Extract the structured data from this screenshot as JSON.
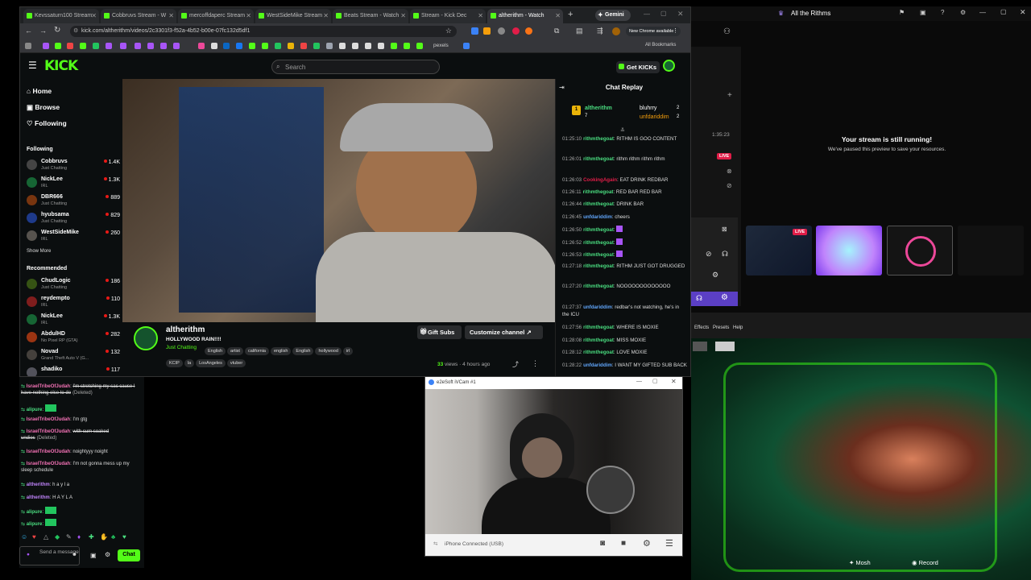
{
  "browser": {
    "tabs": [
      "Kevssaturn100 Stream",
      "Cobbruvs Stream - W",
      "mercoffdaperc Stream",
      "WestSideMike Stream",
      "Beats Stream - Watch",
      "Stream - Kick Dec",
      "altherithm - Watch"
    ],
    "gemini_label": "Gemini",
    "url": "kick.com/altherithm/videos/2c3301f3-f52a-4b52-b00e-07fc132d5df1",
    "update_label": "New Chrome available",
    "bookmarks_label": "pexels",
    "all_bookmarks": "All Bookmarks"
  },
  "kick": {
    "logo": "KICK",
    "search_placeholder": "Search",
    "get_kicks": "Get KICKs",
    "nav": {
      "home": "Home",
      "browse": "Browse",
      "following": "Following"
    },
    "following_title": "Following",
    "following": [
      {
        "name": "Cobbruvs",
        "category": "Just Chatting",
        "viewers": "1.4K"
      },
      {
        "name": "NickLee",
        "category": "IRL",
        "viewers": "1.3K"
      },
      {
        "name": "DBR666",
        "category": "Just Chatting",
        "viewers": "889"
      },
      {
        "name": "hyubsama",
        "category": "Just Chatting",
        "viewers": "829"
      },
      {
        "name": "WestSideMike",
        "category": "IRL",
        "viewers": "260"
      }
    ],
    "show_more": "Show More",
    "recommended_title": "Recommended",
    "recommended": [
      {
        "name": "ChudLogic",
        "category": "Just Chatting",
        "viewers": "186"
      },
      {
        "name": "reydempto",
        "category": "IRL",
        "viewers": "110"
      },
      {
        "name": "NickLee",
        "category": "IRL",
        "viewers": "1.3K"
      },
      {
        "name": "AbdulHD",
        "category": "No Pixel RP (GTA)",
        "viewers": "282"
      },
      {
        "name": "Novad",
        "category": "Grand Theft Auto V (G...",
        "viewers": "132"
      },
      {
        "name": "shadiko",
        "category": "",
        "viewers": "117"
      }
    ],
    "stream": {
      "channel": "altherithm",
      "title": "HOLLYWOOD RAIN!!!!",
      "category": "Just Chatting",
      "tags": [
        "English",
        "artist",
        "california",
        "english",
        "English",
        "hollywood",
        "irl"
      ],
      "tags2": [
        "KCIP",
        "la",
        "LosAngeles",
        "vtuber"
      ],
      "gift_subs": "Gift Subs",
      "customize": "Customize channel",
      "views": "33",
      "views_label": "views",
      "time_ago": "4 hours ago"
    },
    "chat": {
      "title": "Chat Replay",
      "leaders": [
        {
          "rank": "1",
          "name": "altherithm",
          "count": "7"
        },
        {
          "name": "bluhrry",
          "count": "2"
        },
        {
          "name": "unfdariddim",
          "count": "2"
        }
      ],
      "messages": [
        {
          "time": "01:25:10",
          "user": "rithmthegoat",
          "text": "RITHM IS GOO CONTENT",
          "color": "#4ade80"
        },
        {
          "time": "01:26:01",
          "user": "rithmthegoat",
          "text": "rithm rithm rithm rithm",
          "color": "#4ade80"
        },
        {
          "time": "01:26:03",
          "user": "CookingAgain",
          "text": "EAT DRINK REDBAR",
          "color": "#e11d48"
        },
        {
          "time": "01:26:11",
          "user": "rithmthegoat",
          "text": "RED BAR RED BAR",
          "color": "#4ade80"
        },
        {
          "time": "01:26:44",
          "user": "rithmthegoat",
          "text": "DRINK BAR",
          "color": "#4ade80"
        },
        {
          "time": "01:26:45",
          "user": "unfdariddim",
          "text": "cheers",
          "color": "#60a5fa"
        },
        {
          "time": "01:26:50",
          "user": "rithmthegoat",
          "text": "",
          "color": "#4ade80"
        },
        {
          "time": "01:26:52",
          "user": "rithmthegoat",
          "text": "",
          "color": "#4ade80"
        },
        {
          "time": "01:26:53",
          "user": "rithmthegoat",
          "text": "",
          "color": "#4ade80"
        },
        {
          "time": "01:27:18",
          "user": "rithmthegoat",
          "text": "RITHM JUST GOT DRUGGED",
          "color": "#4ade80"
        },
        {
          "time": "01:27:20",
          "user": "rithmthegoat",
          "text": "NOOOOOOOOOOOOO",
          "color": "#4ade80"
        },
        {
          "time": "01:27:37",
          "user": "unfdariddim",
          "text": "redbar's not watching, he's in the ICU",
          "color": "#60a5fa"
        },
        {
          "time": "01:27:56",
          "user": "rithmthegoat",
          "text": "WHERE IS MOXIE",
          "color": "#4ade80"
        },
        {
          "time": "01:28:08",
          "user": "rithmthegoat",
          "text": "MISS MOXIE",
          "color": "#4ade80"
        },
        {
          "time": "01:28:12",
          "user": "rithmthegoat",
          "text": "LOVE MOXIE",
          "color": "#4ade80"
        },
        {
          "time": "01:28:22",
          "user": "unfdariddim",
          "text": "I WANT MY GIFTED SUB BACK",
          "color": "#60a5fa"
        }
      ]
    }
  },
  "leftchat": {
    "messages": [
      {
        "user": "IsraelTribeOfJudah",
        "text": "I'm stretching my sac cause I have nothing else to do",
        "note": "(Deleted)",
        "color": "#f472b6",
        "strike": true
      },
      {
        "user": "alipure",
        "text": "",
        "note": "",
        "color": "#4ade80",
        "strike": false
      },
      {
        "user": "IsraelTribeOfJudah",
        "text": "I'm gtg",
        "note": "",
        "color": "#f472b6",
        "strike": false
      },
      {
        "user": "IsraelTribeOfJudah",
        "text": "with cum soaked undies",
        "note": "(Deleted)",
        "color": "#f472b6",
        "strike": true
      },
      {
        "user": "IsraelTribeOfJudah",
        "text": "noightyyy noight",
        "note": "",
        "color": "#f472b6",
        "strike": false
      },
      {
        "user": "IsraelTribeOfJudah",
        "text": "I'm not gonna mess up my sleep schedule",
        "note": "",
        "color": "#f472b6",
        "strike": false
      },
      {
        "user": "altherithm",
        "text": "h a y l a",
        "note": "",
        "color": "#c084fc",
        "strike": false
      },
      {
        "user": "altherithm",
        "text": "H A Y L A",
        "note": "",
        "color": "#c084fc",
        "strike": false
      },
      {
        "user": "alipure",
        "text": "",
        "note": "",
        "color": "#4ade80",
        "strike": false
      },
      {
        "user": "alipure",
        "text": "",
        "note": "",
        "color": "#4ade80",
        "strike": false
      }
    ],
    "input_placeholder": "Send a message",
    "chat_button": "Chat"
  },
  "webcam": {
    "title": "e2eSoft iVCam #1",
    "status": "iPhone Connected (USB)"
  },
  "streamlabs": {
    "title": "All the Rithms",
    "timer": "1:35:23",
    "live_badge": "LIVE",
    "running_title": "Your stream is still running!",
    "running_sub": "We've paused this preview to save your resources.",
    "live_label": "LIVE"
  },
  "obs": {
    "menu": [
      "Effects",
      "Presets",
      "Help"
    ],
    "mosh": "Mosh",
    "record": "Record"
  }
}
